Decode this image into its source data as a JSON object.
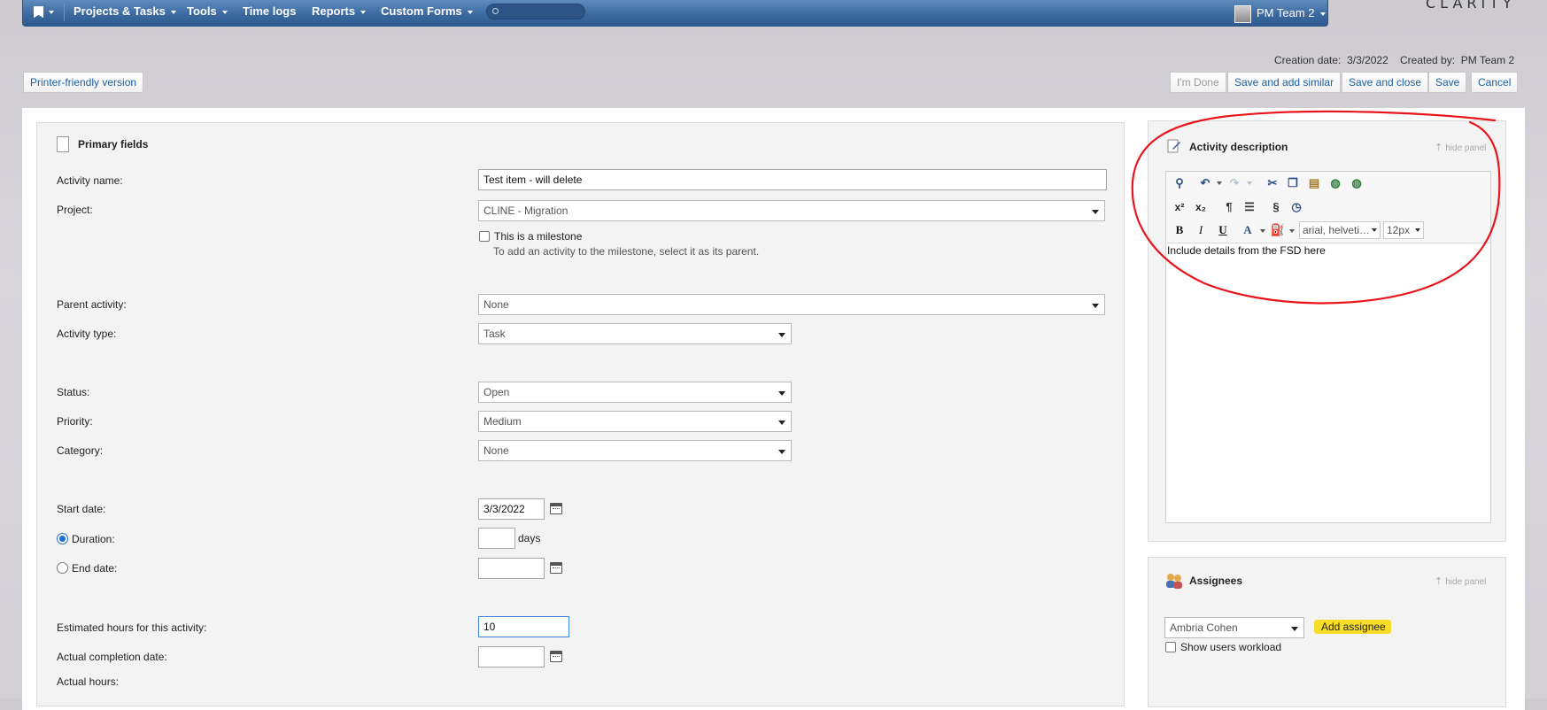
{
  "nav": {
    "items": [
      {
        "label": "Projects & Tasks"
      },
      {
        "label": "Tools"
      },
      {
        "label": "Time logs"
      },
      {
        "label": "Reports"
      },
      {
        "label": "Custom Forms"
      }
    ],
    "user": "PM Team 2",
    "brand": "CLARITY"
  },
  "meta": {
    "creation_label": "Creation date:",
    "creation_value": "3/3/2022",
    "created_by_label": "Created by:",
    "created_by_value": "PM Team 2"
  },
  "actions": {
    "printer": "Printer-friendly version",
    "im_done": "I'm Done",
    "save_add_similar": "Save and add similar",
    "save_close": "Save and close",
    "save": "Save",
    "cancel": "Cancel"
  },
  "primary": {
    "title": "Primary fields",
    "activity_name_label": "Activity name:",
    "activity_name_value": "Test item - will delete",
    "project_label": "Project:",
    "project_value": "CLINE - Migration",
    "milestone_label": "This is a milestone",
    "milestone_hint": "To add an activity to the milestone, select it as its parent.",
    "parent_label": "Parent activity:",
    "parent_value": "None",
    "type_label": "Activity type:",
    "type_value": "Task",
    "status_label": "Status:",
    "status_value": "Open",
    "priority_label": "Priority:",
    "priority_value": "Medium",
    "category_label": "Category:",
    "category_value": "None",
    "start_label": "Start date:",
    "start_value": "3/3/2022",
    "duration_label": "Duration:",
    "duration_value": "",
    "days_label": "days",
    "end_label": "End date:",
    "end_value": "",
    "est_hours_label": "Estimated hours for this activity:",
    "est_hours_value": "10",
    "completion_label": "Actual completion date:",
    "completion_value": "",
    "actual_hours_label": "Actual hours:"
  },
  "description": {
    "title": "Activity description",
    "hide": "hide panel",
    "font_family": "arial, helveti…",
    "font_size": "12px",
    "content": "Include details from the FSD here"
  },
  "assignees": {
    "title": "Assignees",
    "hide": "hide panel",
    "selected": "Ambria Cohen",
    "add_label": "Add assignee",
    "workload_label": "Show users workload"
  },
  "annotation_color": "#e8141b"
}
